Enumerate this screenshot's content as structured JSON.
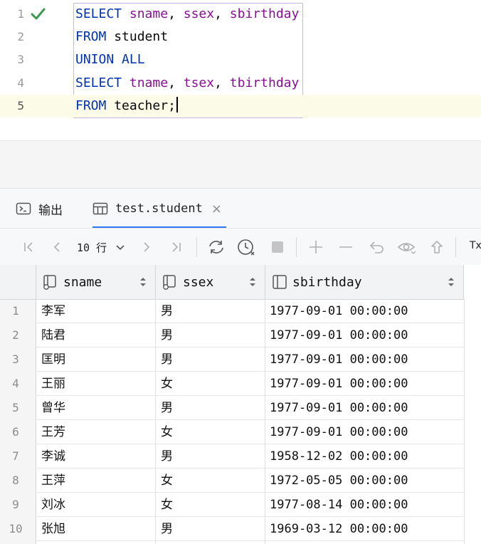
{
  "editor": {
    "lines": [
      {
        "num": "1"
      },
      {
        "num": "2"
      },
      {
        "num": "3"
      },
      {
        "num": "4"
      },
      {
        "num": "5"
      }
    ],
    "kw_select": "SELECT",
    "kw_from": "FROM",
    "kw_union_all": "UNION ALL",
    "line1_col1": "sname",
    "line1_col2": "ssex",
    "line1_col3": "sbirthday",
    "comma": ",",
    "line2_table": "student",
    "line4_col1": "tname",
    "line4_col2": "tsex",
    "line4_col3": "tbirthday",
    "line5_table": "teacher",
    "semicolon": ";"
  },
  "tabs": {
    "output_label": "输出",
    "result_label": "test.student",
    "close_glyph": "×"
  },
  "toolbar": {
    "rows_label": "10 行",
    "tx_label": "Tx"
  },
  "grid": {
    "columns": [
      "sname",
      "ssex",
      "sbirthday"
    ],
    "rows": [
      {
        "n": "1",
        "sname": "李军",
        "ssex": "男",
        "sbirthday": "1977-09-01 00:00:00"
      },
      {
        "n": "2",
        "sname": "陆君",
        "ssex": "男",
        "sbirthday": "1977-09-01 00:00:00"
      },
      {
        "n": "3",
        "sname": "匡明",
        "ssex": "男",
        "sbirthday": "1977-09-01 00:00:00"
      },
      {
        "n": "4",
        "sname": "王丽",
        "ssex": "女",
        "sbirthday": "1977-09-01 00:00:00"
      },
      {
        "n": "5",
        "sname": "曾华",
        "ssex": "男",
        "sbirthday": "1977-09-01 00:00:00"
      },
      {
        "n": "6",
        "sname": "王芳",
        "ssex": "女",
        "sbirthday": "1977-09-01 00:00:00"
      },
      {
        "n": "7",
        "sname": "李诚",
        "ssex": "男",
        "sbirthday": "1958-12-02 00:00:00"
      },
      {
        "n": "8",
        "sname": "王萍",
        "ssex": "女",
        "sbirthday": "1972-05-05 00:00:00"
      },
      {
        "n": "9",
        "sname": "刘冰",
        "ssex": "女",
        "sbirthday": "1977-08-14 00:00:00"
      },
      {
        "n": "10",
        "sname": "张旭",
        "ssex": "男",
        "sbirthday": "1969-03-12 00:00:00"
      }
    ]
  },
  "colors": {
    "keyword": "#0033b3",
    "column": "#871094",
    "accent": "#3574f0",
    "check": "#3c9a4f"
  }
}
